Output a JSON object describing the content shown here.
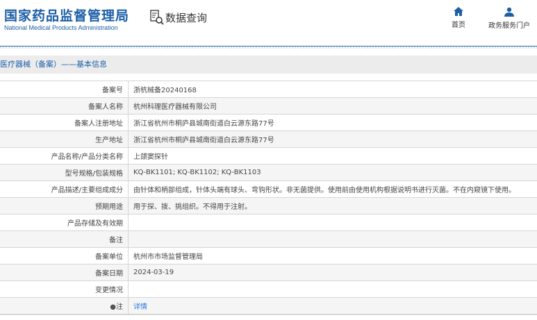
{
  "header": {
    "logo_cn": "国家药品监督管理局",
    "logo_en": "National Medical Products Administration",
    "query_title": "数据查询",
    "nav": [
      {
        "label": "首页",
        "icon": "home-icon"
      },
      {
        "label": "政务服务门户",
        "icon": "user-icon"
      }
    ]
  },
  "section_title": "医疗器械（备案）——基本信息",
  "rows": [
    {
      "label": "备案号",
      "value": "浙杭械备20240168"
    },
    {
      "label": "备案人名称",
      "value": "杭州科理医疗器械有限公司"
    },
    {
      "label": "备案人注册地址",
      "value": "浙江省杭州市桐庐县城南街道白云源东路77号"
    },
    {
      "label": "生产地址",
      "value": "浙江省杭州市桐庐县城南街道白云源东路77号"
    },
    {
      "label": "产品名称/产品分类名称",
      "value": "上颌窦探针"
    },
    {
      "label": "型号规格/包装规格",
      "value": "KQ-BK1101; KQ-BK1102; KQ-BK1103"
    },
    {
      "label": "产品描述/主要组成成分",
      "value": "由针体和柄部组成，针体头端有球头、弯钩形状。非无菌提供。使用前由使用机构根据说明书进行灭菌。不在内窥镜下使用。"
    },
    {
      "label": "预期用途",
      "value": "用于探、拨、挑组织。不得用于注射。"
    },
    {
      "label": "产品存储及有效期",
      "value": ""
    },
    {
      "label": "备注",
      "value": ""
    },
    {
      "label": "备案单位",
      "value": "杭州市市场监督管理局"
    },
    {
      "label": "备案日期",
      "value": "2024-03-19"
    },
    {
      "label": "变更情况",
      "value": ""
    },
    {
      "label": "注",
      "value": "详情"
    }
  ]
}
